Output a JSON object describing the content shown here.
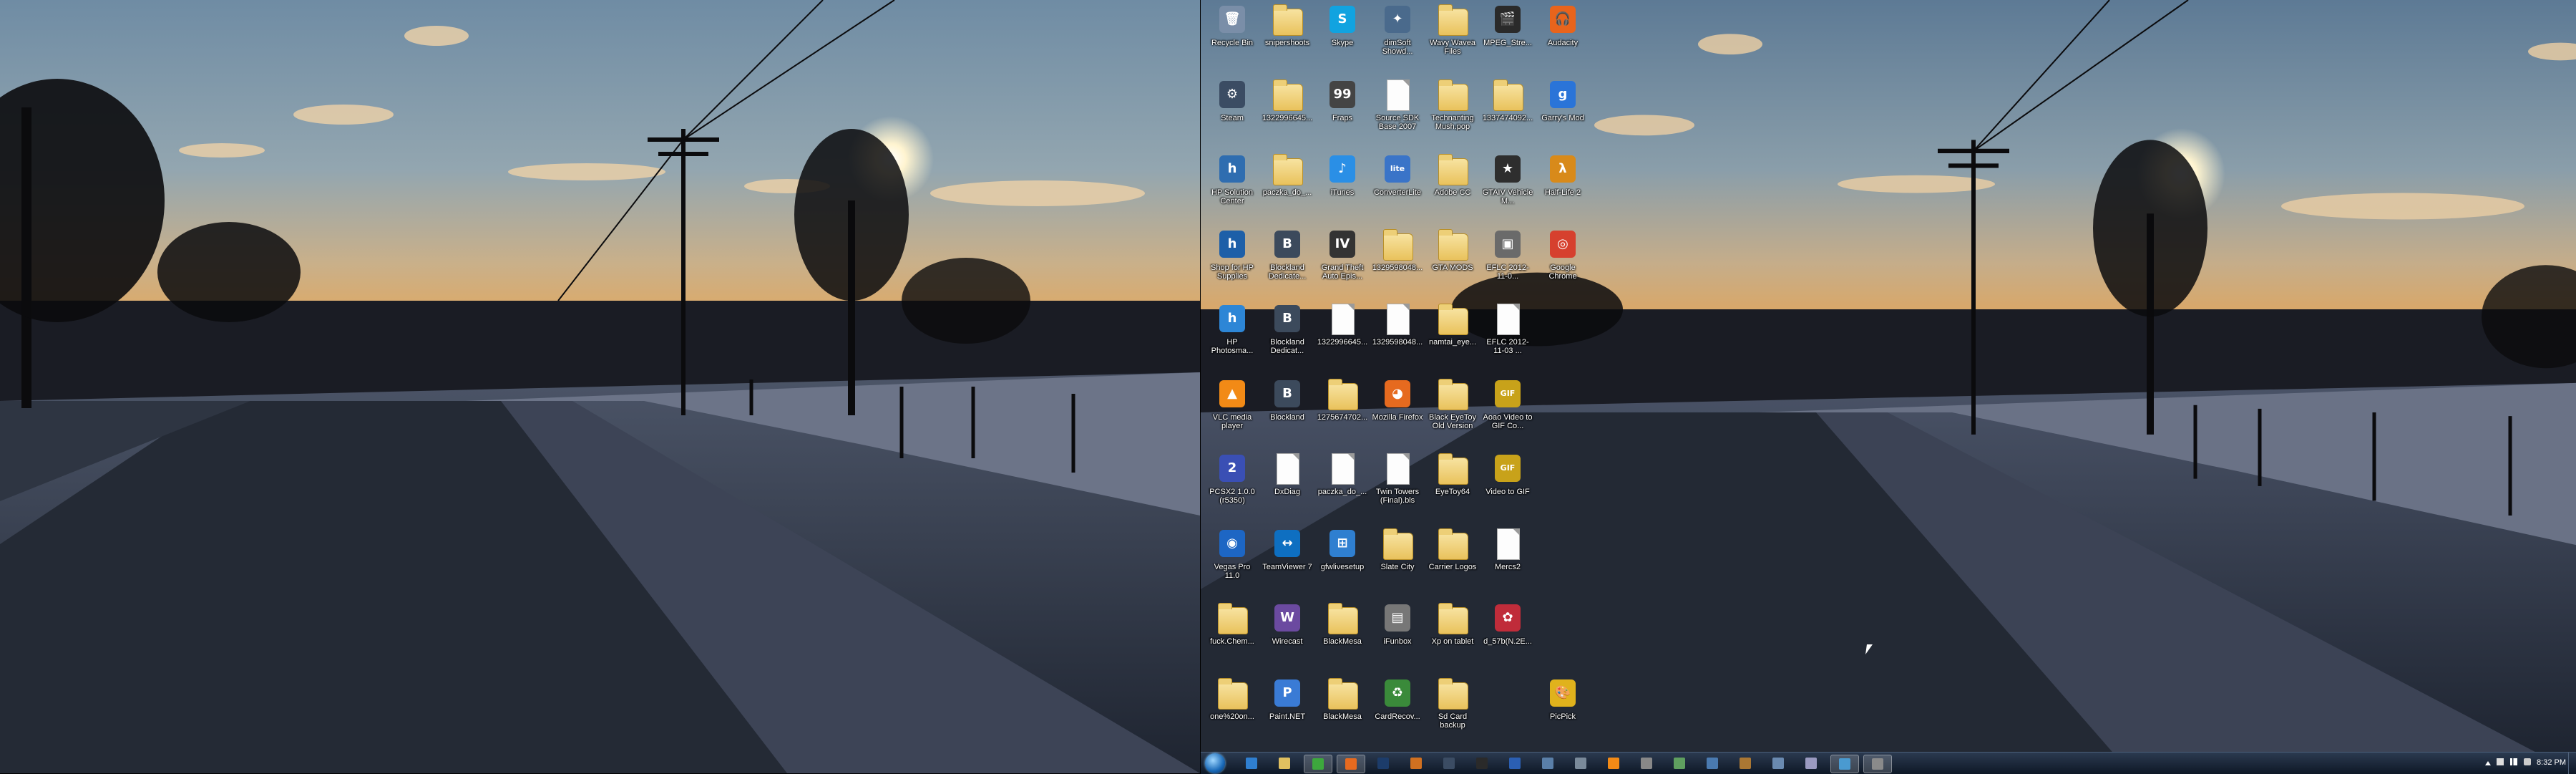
{
  "desktop_icons": [
    {
      "label": "Recycle Bin",
      "type": "app",
      "icon": "recycle-bin-icon",
      "color": "#7a8ea8",
      "glyph": "🗑"
    },
    {
      "label": "Steam",
      "type": "app",
      "icon": "steam-icon",
      "color": "#3b4c63",
      "glyph": "⚙"
    },
    {
      "label": "HP Solution Center",
      "type": "app",
      "icon": "hp-solution-center-icon",
      "color": "#2f6db0",
      "glyph": "h"
    },
    {
      "label": "Shop for HP Supplies",
      "type": "app",
      "icon": "hp-supplies-icon",
      "color": "#1d5fa8",
      "glyph": "h"
    },
    {
      "label": "HP Photosma...",
      "type": "app",
      "icon": "hp-photosmart-icon",
      "color": "#2d86d6",
      "glyph": "h"
    },
    {
      "label": "VLC media player",
      "type": "app",
      "icon": "vlc-icon",
      "color": "#f28a16",
      "glyph": "▲"
    },
    {
      "label": "PCSX2 1.0.0 (r5350)",
      "type": "app",
      "icon": "pcsx2-icon",
      "color": "#3a4fb4",
      "glyph": "2"
    },
    {
      "label": "Vegas Pro 11.0",
      "type": "app",
      "icon": "vegas-pro-icon",
      "color": "#1d66c4",
      "glyph": "◉"
    },
    {
      "label": "fuck.Chem...",
      "type": "folder",
      "icon": "folder-icon"
    },
    {
      "label": "one%20on...",
      "type": "folder",
      "icon": "folder-icon"
    },
    {
      "label": "snipershoots",
      "type": "folder",
      "icon": "folder-icon"
    },
    {
      "label": "1322996645...",
      "type": "folder",
      "icon": "folder-icon"
    },
    {
      "label": "paczka_do_...",
      "type": "folder",
      "icon": "folder-icon"
    },
    {
      "label": "Blockland Dedicate...",
      "type": "app",
      "icon": "blockland-icon",
      "color": "#3c4a5c",
      "glyph": "B"
    },
    {
      "label": "Blockland Dedicat...",
      "type": "app",
      "icon": "blockland-icon",
      "color": "#3c4a5c",
      "glyph": "B"
    },
    {
      "label": "Blockland",
      "type": "app",
      "icon": "blockland-icon",
      "color": "#3c4a5c",
      "glyph": "B"
    },
    {
      "label": "DxDiag",
      "type": "file",
      "icon": "file-icon"
    },
    {
      "label": "TeamViewer 7",
      "type": "app",
      "icon": "teamviewer-icon",
      "color": "#0e6fc1",
      "glyph": "↔"
    },
    {
      "label": "Wirecast",
      "type": "app",
      "icon": "wirecast-icon",
      "color": "#6b4aa0",
      "glyph": "W"
    },
    {
      "label": "Paint.NET",
      "type": "app",
      "icon": "paint-net-icon",
      "color": "#3a7bd5",
      "glyph": "P"
    },
    {
      "label": "Skype",
      "type": "app",
      "icon": "skype-icon",
      "color": "#11a3e0",
      "glyph": "S"
    },
    {
      "label": "Fraps",
      "type": "app",
      "icon": "fraps-icon",
      "color": "#444444",
      "glyph": "99"
    },
    {
      "label": "iTunes",
      "type": "app",
      "icon": "itunes-icon",
      "color": "#2a8fe6",
      "glyph": "♪"
    },
    {
      "label": "Grand Theft Auto Epis...",
      "type": "app",
      "icon": "gta-icon",
      "color": "#333333",
      "glyph": "IV"
    },
    {
      "label": "1322996645...",
      "type": "file",
      "icon": "file-icon"
    },
    {
      "label": "1275674702...",
      "type": "folder",
      "icon": "folder-icon"
    },
    {
      "label": "paczka_do_...",
      "type": "file",
      "icon": "file-icon"
    },
    {
      "label": "gfwlivesetup",
      "type": "app",
      "icon": "windows-setup-icon",
      "color": "#2f7fd0",
      "glyph": "⊞"
    },
    {
      "label": "BlackMesa",
      "type": "folder",
      "icon": "folder-icon"
    },
    {
      "label": "BlackMesa",
      "type": "folder",
      "icon": "folder-icon"
    },
    {
      "label": "dimSoft Showd...",
      "type": "app",
      "icon": "dimsoft-icon",
      "color": "#4a6a8c",
      "glyph": "✦"
    },
    {
      "label": "Source SDK Base 2007",
      "type": "file",
      "icon": "file-icon"
    },
    {
      "label": "ConverterLite",
      "type": "app",
      "icon": "converterlite-icon",
      "color": "#3a74c8",
      "glyph": "lite"
    },
    {
      "label": "1329598048...",
      "type": "folder",
      "icon": "folder-icon"
    },
    {
      "label": "1329598048...",
      "type": "file",
      "icon": "file-icon"
    },
    {
      "label": "Mozilla Firefox",
      "type": "app",
      "icon": "firefox-icon",
      "color": "#e66a1f",
      "glyph": "◕"
    },
    {
      "label": "Twin Towers (Final).bls",
      "type": "file",
      "icon": "file-icon"
    },
    {
      "label": "Slate City",
      "type": "folder",
      "icon": "folder-icon"
    },
    {
      "label": "iFunbox",
      "type": "app",
      "icon": "ifunbox-icon",
      "color": "#777777",
      "glyph": "▤"
    },
    {
      "label": "CardRecov...",
      "type": "app",
      "icon": "cardrecovery-icon",
      "color": "#3a8a3a",
      "glyph": "♻"
    },
    {
      "label": "Wavy Wavea Files",
      "type": "folder",
      "icon": "folder-icon"
    },
    {
      "label": "Technanting Mush.pop",
      "type": "folder",
      "icon": "folder-icon"
    },
    {
      "label": "Adobe CC",
      "type": "folder",
      "icon": "folder-icon"
    },
    {
      "label": "GTA MODS",
      "type": "folder",
      "icon": "folder-icon"
    },
    {
      "label": "namtai_eye...",
      "type": "folder",
      "icon": "folder-icon"
    },
    {
      "label": "Black EyeToy Old Version",
      "type": "folder",
      "icon": "folder-icon"
    },
    {
      "label": "EyeToy64",
      "type": "folder",
      "icon": "folder-icon"
    },
    {
      "label": "Carrier Logos",
      "type": "folder",
      "icon": "folder-icon"
    },
    {
      "label": "Xp on tablet",
      "type": "folder",
      "icon": "folder-icon"
    },
    {
      "label": "Sd Card backup",
      "type": "folder",
      "icon": "folder-icon"
    },
    {
      "label": "MPEG_Stre...",
      "type": "app",
      "icon": "mpeg-streamclip-icon",
      "color": "#2a2a2a",
      "glyph": "🎬"
    },
    {
      "label": "1337474092...",
      "type": "folder",
      "icon": "folder-icon"
    },
    {
      "label": "GTAIV Vehicle M...",
      "type": "app",
      "icon": "gta-vehicle-icon",
      "color": "#2e2e2e",
      "glyph": "★"
    },
    {
      "label": "EFLC 2012-11-0...",
      "type": "app",
      "icon": "eflc-icon",
      "color": "#6a6a6a",
      "glyph": "▣"
    },
    {
      "label": "EFLC 2012-11-03 ...",
      "type": "file",
      "icon": "file-icon"
    },
    {
      "label": "Aoao Video to GIF Co...",
      "type": "app",
      "icon": "aoao-gif-icon",
      "color": "#c8a21a",
      "glyph": "GIF"
    },
    {
      "label": "Video to GIF",
      "type": "app",
      "icon": "video-to-gif-icon",
      "color": "#c8a21a",
      "glyph": "GIF"
    },
    {
      "label": "Mercs2",
      "type": "file",
      "icon": "file-icon"
    },
    {
      "label": "d_57b(N.2E...",
      "type": "app",
      "icon": "image-file-icon",
      "color": "#c02c3a",
      "glyph": "✿"
    },
    {
      "label": "",
      "type": "none"
    },
    {
      "label": "Audacity",
      "type": "app",
      "icon": "audacity-icon",
      "color": "#e8641c",
      "glyph": "🎧"
    },
    {
      "label": "Garry's Mod",
      "type": "app",
      "icon": "garrys-mod-icon",
      "color": "#2a74d8",
      "glyph": "g"
    },
    {
      "label": "Half-Life 2",
      "type": "app",
      "icon": "half-life-2-icon",
      "color": "#d88a1a",
      "glyph": "λ"
    },
    {
      "label": "Google Chrome",
      "type": "app",
      "icon": "chrome-icon",
      "color": "#d6402e",
      "glyph": "◎"
    },
    {
      "label": "",
      "type": "none"
    },
    {
      "label": "",
      "type": "none"
    },
    {
      "label": "",
      "type": "none"
    },
    {
      "label": "",
      "type": "none"
    },
    {
      "label": "",
      "type": "none"
    },
    {
      "label": "PicPick",
      "type": "app",
      "icon": "picpick-icon",
      "color": "#e0b21c",
      "glyph": "🎨"
    }
  ],
  "taskbar": {
    "start_label": "Start",
    "buttons": [
      {
        "icon": "ie-icon",
        "color": "#2f7fd0",
        "active": false
      },
      {
        "icon": "explorer-icon",
        "color": "#e0c060",
        "active": false
      },
      {
        "icon": "green-app-icon",
        "color": "#3da83d",
        "active": true
      },
      {
        "icon": "firefox-icon",
        "color": "#e66a1f",
        "active": true
      },
      {
        "icon": "photoshop-icon",
        "color": "#1c3c6a",
        "active": false
      },
      {
        "icon": "media-icon",
        "color": "#d07020",
        "active": false
      },
      {
        "icon": "steam-icon",
        "color": "#3b4c63",
        "active": false
      },
      {
        "icon": "terminal-icon",
        "color": "#2a2a2a",
        "active": false
      },
      {
        "icon": "word-icon",
        "color": "#2b5fb3",
        "active": false
      },
      {
        "icon": "window-icon",
        "color": "#5a7fa8",
        "active": false
      },
      {
        "icon": "settings-icon",
        "color": "#7a8a9a",
        "active": false
      },
      {
        "icon": "vlc-icon",
        "color": "#f28a16",
        "active": false
      },
      {
        "icon": "usb-icon",
        "color": "#888888",
        "active": false
      },
      {
        "icon": "image-icon",
        "color": "#5f9f5f",
        "active": false
      },
      {
        "icon": "explorer-window-icon",
        "color": "#4a7ab0",
        "active": false
      },
      {
        "icon": "tool-icon",
        "color": "#aa7733",
        "active": false
      },
      {
        "icon": "screen-icon",
        "color": "#6a8ab0",
        "active": false
      },
      {
        "icon": "disc-icon",
        "color": "#9a9ac0",
        "active": false
      },
      {
        "icon": "capture-icon",
        "color": "#4a9ad0",
        "active": true
      },
      {
        "icon": "printer-icon",
        "color": "#8a8a8a",
        "active": true
      }
    ],
    "clock": "8:32 PM"
  }
}
